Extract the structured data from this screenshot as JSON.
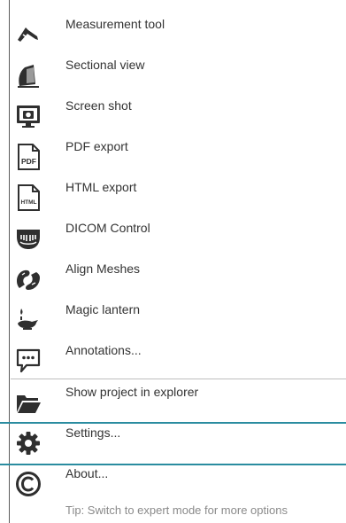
{
  "menu": {
    "items": [
      {
        "label": "Measurement tool",
        "icon": "measurement-icon"
      },
      {
        "label": "Sectional view",
        "icon": "sectional-view-icon"
      },
      {
        "label": "Screen shot",
        "icon": "screenshot-icon"
      },
      {
        "label": "PDF export",
        "icon": "pdf-icon"
      },
      {
        "label": "HTML export",
        "icon": "html-icon"
      },
      {
        "label": "DICOM Control",
        "icon": "dicom-icon"
      },
      {
        "label": "Align Meshes",
        "icon": "align-meshes-icon"
      },
      {
        "label": "Magic lantern",
        "icon": "magic-lantern-icon"
      },
      {
        "label": "Annotations...",
        "icon": "annotations-icon"
      },
      {
        "label": "Show project in explorer",
        "icon": "folder-icon"
      },
      {
        "label": "Settings...",
        "icon": "gear-icon"
      },
      {
        "label": "About...",
        "icon": "copyright-icon"
      }
    ],
    "pdf_icon_text": "PDF",
    "html_icon_text": "HTML",
    "tip": "Tip: Switch to expert mode for more options"
  },
  "colors": {
    "icon": "#2f2f2f",
    "highlight": "#2a8ca0",
    "separator": "#bdbdbd",
    "tip_text": "#8a8a8a"
  }
}
